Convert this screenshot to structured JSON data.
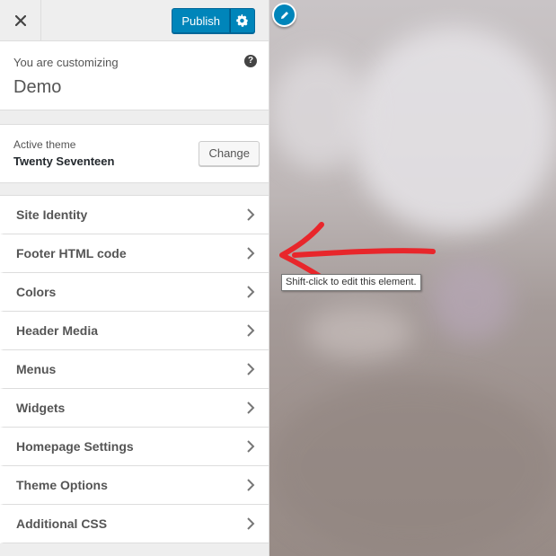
{
  "header": {
    "close_icon": "close-icon",
    "publish_label": "Publish",
    "settings_icon": "gear-icon"
  },
  "info": {
    "customizing_label": "You are customizing",
    "site_name": "Demo",
    "help_icon": "?"
  },
  "theme": {
    "active_label": "Active theme",
    "name": "Twenty Seventeen",
    "change_label": "Change"
  },
  "menu": {
    "items": [
      {
        "label": "Site Identity"
      },
      {
        "label": "Footer HTML code"
      },
      {
        "label": "Colors"
      },
      {
        "label": "Header Media"
      },
      {
        "label": "Menus"
      },
      {
        "label": "Widgets"
      },
      {
        "label": "Homepage Settings"
      },
      {
        "label": "Theme Options"
      },
      {
        "label": "Additional CSS"
      }
    ]
  },
  "preview": {
    "edit_icon": "pencil-icon",
    "tooltip": "Shift-click to edit this element.",
    "arrow_color": "#e8262b"
  },
  "colors": {
    "accent": "#0085ba"
  }
}
